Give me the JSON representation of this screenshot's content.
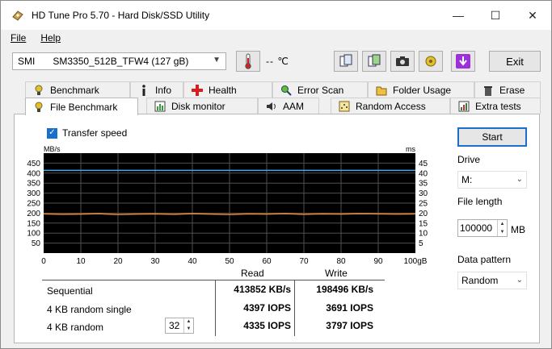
{
  "window": {
    "title": "HD Tune Pro 5.70 - Hard Disk/SSD Utility",
    "minimize_icon": "minimize-icon",
    "maximize_icon": "maximize-icon",
    "close_icon": "close-icon"
  },
  "menu": {
    "file": "File",
    "help": "Help"
  },
  "toolbar": {
    "drive_prefix": "SMI",
    "drive_model": "SM3350_512B_TFW4 (127 gB)",
    "temperature": "-- ℃",
    "exit_label": "Exit"
  },
  "tabs": {
    "row1": [
      {
        "label": "Benchmark",
        "icon": "benchmark-icon"
      },
      {
        "label": "Info",
        "icon": "info-icon"
      },
      {
        "label": "Health",
        "icon": "health-icon"
      },
      {
        "label": "Error Scan",
        "icon": "error-scan-icon"
      },
      {
        "label": "Folder Usage",
        "icon": "folder-icon"
      },
      {
        "label": "Erase",
        "icon": "erase-icon"
      }
    ],
    "row2": [
      {
        "label": "File Benchmark",
        "icon": "file-benchmark-icon"
      },
      {
        "label": "Disk monitor",
        "icon": "disk-monitor-icon"
      },
      {
        "label": "AAM",
        "icon": "speaker-icon"
      },
      {
        "label": "Random Access",
        "icon": "random-access-icon"
      },
      {
        "label": "Extra tests",
        "icon": "extra-tests-icon"
      }
    ]
  },
  "options": {
    "transfer_speed_label": "Transfer speed",
    "transfer_speed_checked": true
  },
  "graph": {
    "left_unit": "MB/s",
    "right_unit": "ms",
    "y_left_ticks": [
      "450",
      "400",
      "350",
      "300",
      "250",
      "200",
      "150",
      "100",
      "50"
    ],
    "y_right_ticks": [
      "45",
      "40",
      "35",
      "30",
      "25",
      "20",
      "15",
      "10",
      "5"
    ],
    "x_ticks": [
      "0",
      "10",
      "20",
      "30",
      "40",
      "50",
      "60",
      "70",
      "80",
      "90",
      "100gB"
    ],
    "colors": {
      "background": "#000000",
      "grid": "#505050",
      "read_line": "#4aa8e8",
      "write_line": "#e8883a"
    }
  },
  "chart_data": {
    "type": "line",
    "xlabel": "",
    "ylabel": "MB/s",
    "xlim": [
      0,
      100
    ],
    "ylim": [
      0,
      450
    ],
    "grid": true,
    "series": [
      {
        "name": "Read",
        "x": [
          0,
          100
        ],
        "values": [
          413.9,
          413.9
        ]
      },
      {
        "name": "Write",
        "x": [
          0,
          5,
          10,
          15,
          20,
          25,
          30,
          35,
          40,
          45,
          50,
          55,
          60,
          65,
          70,
          75,
          80,
          85,
          90,
          95,
          100
        ],
        "values": [
          196,
          194,
          195,
          197,
          193,
          195,
          196,
          194,
          197,
          195,
          193,
          196,
          195,
          197,
          194,
          196,
          195,
          197,
          196,
          195,
          196
        ]
      }
    ]
  },
  "results": {
    "col_read": "Read",
    "col_write": "Write",
    "rows": [
      {
        "label": "Sequential",
        "read": "413852 KB/s",
        "write": "198496 KB/s"
      },
      {
        "label": "4 KB random single",
        "read": "4397 IOPS",
        "write": "3691 IOPS"
      },
      {
        "label": "4 KB random",
        "read": "4335 IOPS",
        "write": "3797 IOPS"
      }
    ],
    "queue_depth": "32"
  },
  "side": {
    "start_label": "Start",
    "drive_label": "Drive",
    "drive_value": "M:",
    "file_length_label": "File length",
    "file_length_value": "100000",
    "file_length_unit": "MB",
    "data_pattern_label": "Data pattern",
    "data_pattern_value": "Random"
  }
}
